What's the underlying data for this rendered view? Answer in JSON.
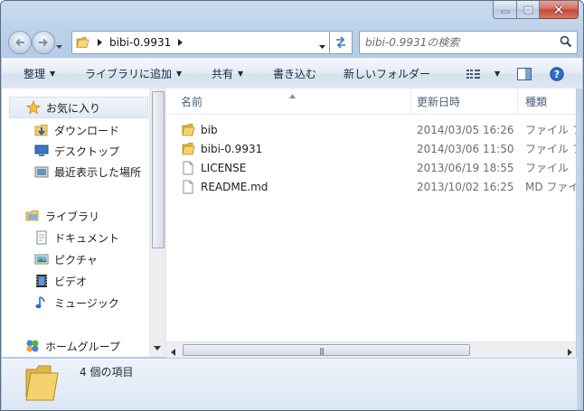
{
  "address": {
    "path": "bibi-0.9931"
  },
  "search": {
    "placeholder": "bibi-0.9931の検索"
  },
  "toolbar": {
    "organize": "整理",
    "add_to_library": "ライブラリに追加",
    "share": "共有",
    "burn": "書き込む",
    "new_folder": "新しいフォルダー"
  },
  "sidebar": {
    "favorites": {
      "label": "お気に入り",
      "items": [
        {
          "label": "ダウンロード"
        },
        {
          "label": "デスクトップ"
        },
        {
          "label": "最近表示した場所"
        }
      ]
    },
    "libraries": {
      "label": "ライブラリ",
      "items": [
        {
          "label": "ドキュメント"
        },
        {
          "label": "ピクチャ"
        },
        {
          "label": "ビデオ"
        },
        {
          "label": "ミュージック"
        }
      ]
    },
    "homegroup": {
      "label": "ホームグループ"
    }
  },
  "columns": {
    "name": "名前",
    "date": "更新日時",
    "type": "種類"
  },
  "files": [
    {
      "name": "bib",
      "date": "2014/03/05 16:26",
      "type": "ファイル フ",
      "icon": "folder-icon"
    },
    {
      "name": "bibi-0.9931",
      "date": "2014/03/06 11:50",
      "type": "ファイル フ",
      "icon": "folder-icon"
    },
    {
      "name": "LICENSE",
      "date": "2013/06/19 18:55",
      "type": "ファイル",
      "icon": "file-icon"
    },
    {
      "name": "README.md",
      "date": "2013/10/02 16:25",
      "type": "MD ファイ",
      "icon": "file-icon"
    }
  ],
  "status": {
    "item_count": "4 個の項目"
  }
}
